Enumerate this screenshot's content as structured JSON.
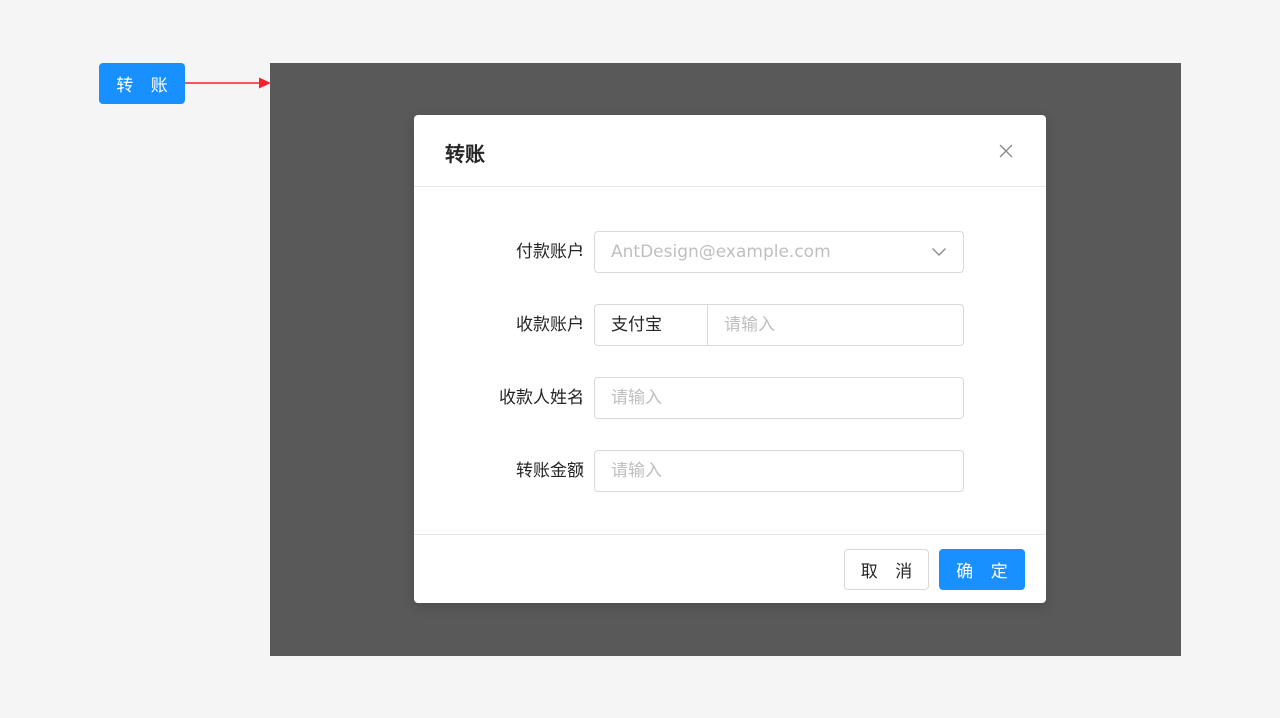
{
  "trigger": {
    "label": "转 账"
  },
  "modal": {
    "title": "转账",
    "fields": [
      {
        "label": "付款账户",
        "colon": ":",
        "placeholder": "AntDesign@example.com",
        "type": "select"
      },
      {
        "label": "收款账户",
        "colon": ":",
        "addon": "支付宝",
        "placeholder": "请输入",
        "type": "addon-input"
      },
      {
        "label": "收款人姓名",
        "colon": ":",
        "placeholder": "请输入",
        "type": "input"
      },
      {
        "label": "转账金额",
        "colon": ":",
        "placeholder": "请输入",
        "type": "input"
      }
    ],
    "footer": {
      "cancel_label": "取 消",
      "ok_label": "确 定"
    }
  },
  "colors": {
    "primary": "#1890ff",
    "arrow": "#f5222d",
    "overlay": "#595959",
    "border": "#d9d9d9",
    "placeholder": "#bfbfbf"
  },
  "icons": {
    "close": "close-icon",
    "select_arrow": "chevron-down-icon",
    "connector": "arrow-right-icon"
  }
}
